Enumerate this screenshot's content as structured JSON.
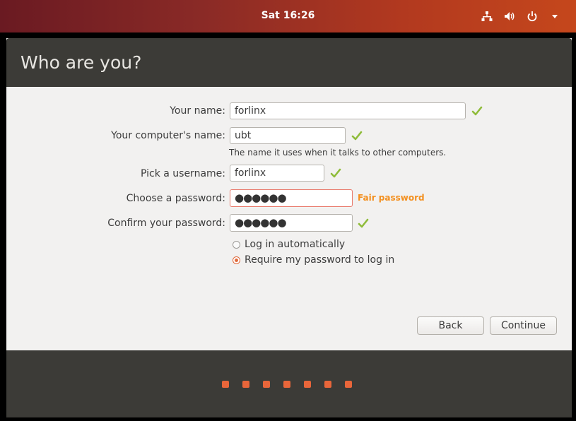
{
  "topbar": {
    "clock": "Sat 16:26",
    "icons": [
      "network-icon",
      "volume-icon",
      "power-icon",
      "menu-arrow-icon"
    ]
  },
  "window": {
    "title": "Who are you?"
  },
  "form": {
    "name": {
      "label": "Your name:",
      "value": "forlinx",
      "valid": true
    },
    "computer_name": {
      "label": "Your computer's name:",
      "value": "ubt",
      "valid": true,
      "hint": "The name it uses when it talks to other computers."
    },
    "username": {
      "label": "Pick a username:",
      "value": "forlinx",
      "valid": true
    },
    "password": {
      "label": "Choose a password:",
      "value": "●●●●●●",
      "strength": "Fair password"
    },
    "confirm_password": {
      "label": "Confirm your password:",
      "value": "●●●●●●",
      "valid": true
    },
    "login_options": [
      {
        "label": "Log in automatically",
        "selected": false
      },
      {
        "label": "Require my password to log in",
        "selected": true
      }
    ]
  },
  "buttons": {
    "back": "Back",
    "continue": "Continue"
  },
  "colors": {
    "accent": "#e9663a",
    "check": "#8fbc3a",
    "strength": "#f39020"
  }
}
